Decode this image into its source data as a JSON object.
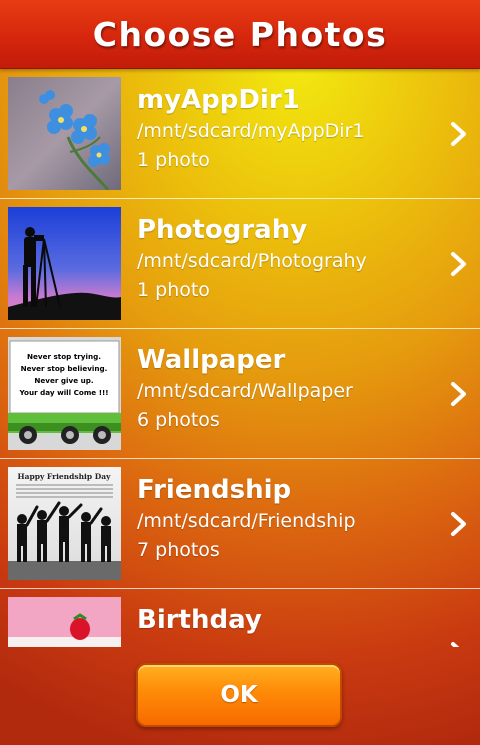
{
  "header": {
    "title": "Choose Photos"
  },
  "albums": [
    {
      "name": "myAppDir1",
      "path": "/mnt/sdcard/myAppDir1",
      "count": "1 photo",
      "thumbnail": "blue-flowers-thumbnail"
    },
    {
      "name": "Photograhy",
      "path": "/mnt/sdcard/Photograhy",
      "count": "1 photo",
      "thumbnail": "photographer-silhouette-thumbnail"
    },
    {
      "name": "Wallpaper",
      "path": "/mnt/sdcard/Wallpaper",
      "count": "6 photos",
      "thumbnail": "quote-truck-thumbnail",
      "thumb_text": [
        "Never stop trying.",
        "Never stop believing.",
        "Never give up.",
        "Your day will Come !!!"
      ]
    },
    {
      "name": "Friendship",
      "path": "/mnt/sdcard/Friendship",
      "count": "7 photos",
      "thumbnail": "friendship-silhouettes-thumbnail",
      "thumb_text": [
        "Happy Friendship Day"
      ]
    },
    {
      "name": "Birthday",
      "path": "",
      "count": "",
      "thumbnail": "birthday-cake-thumbnail"
    }
  ],
  "footer": {
    "ok_label": "OK"
  },
  "colors": {
    "header_red": "#d6260d",
    "button_orange": "#ff8a08",
    "background_yellow": "#f2ea10",
    "background_red": "#c93a10"
  }
}
